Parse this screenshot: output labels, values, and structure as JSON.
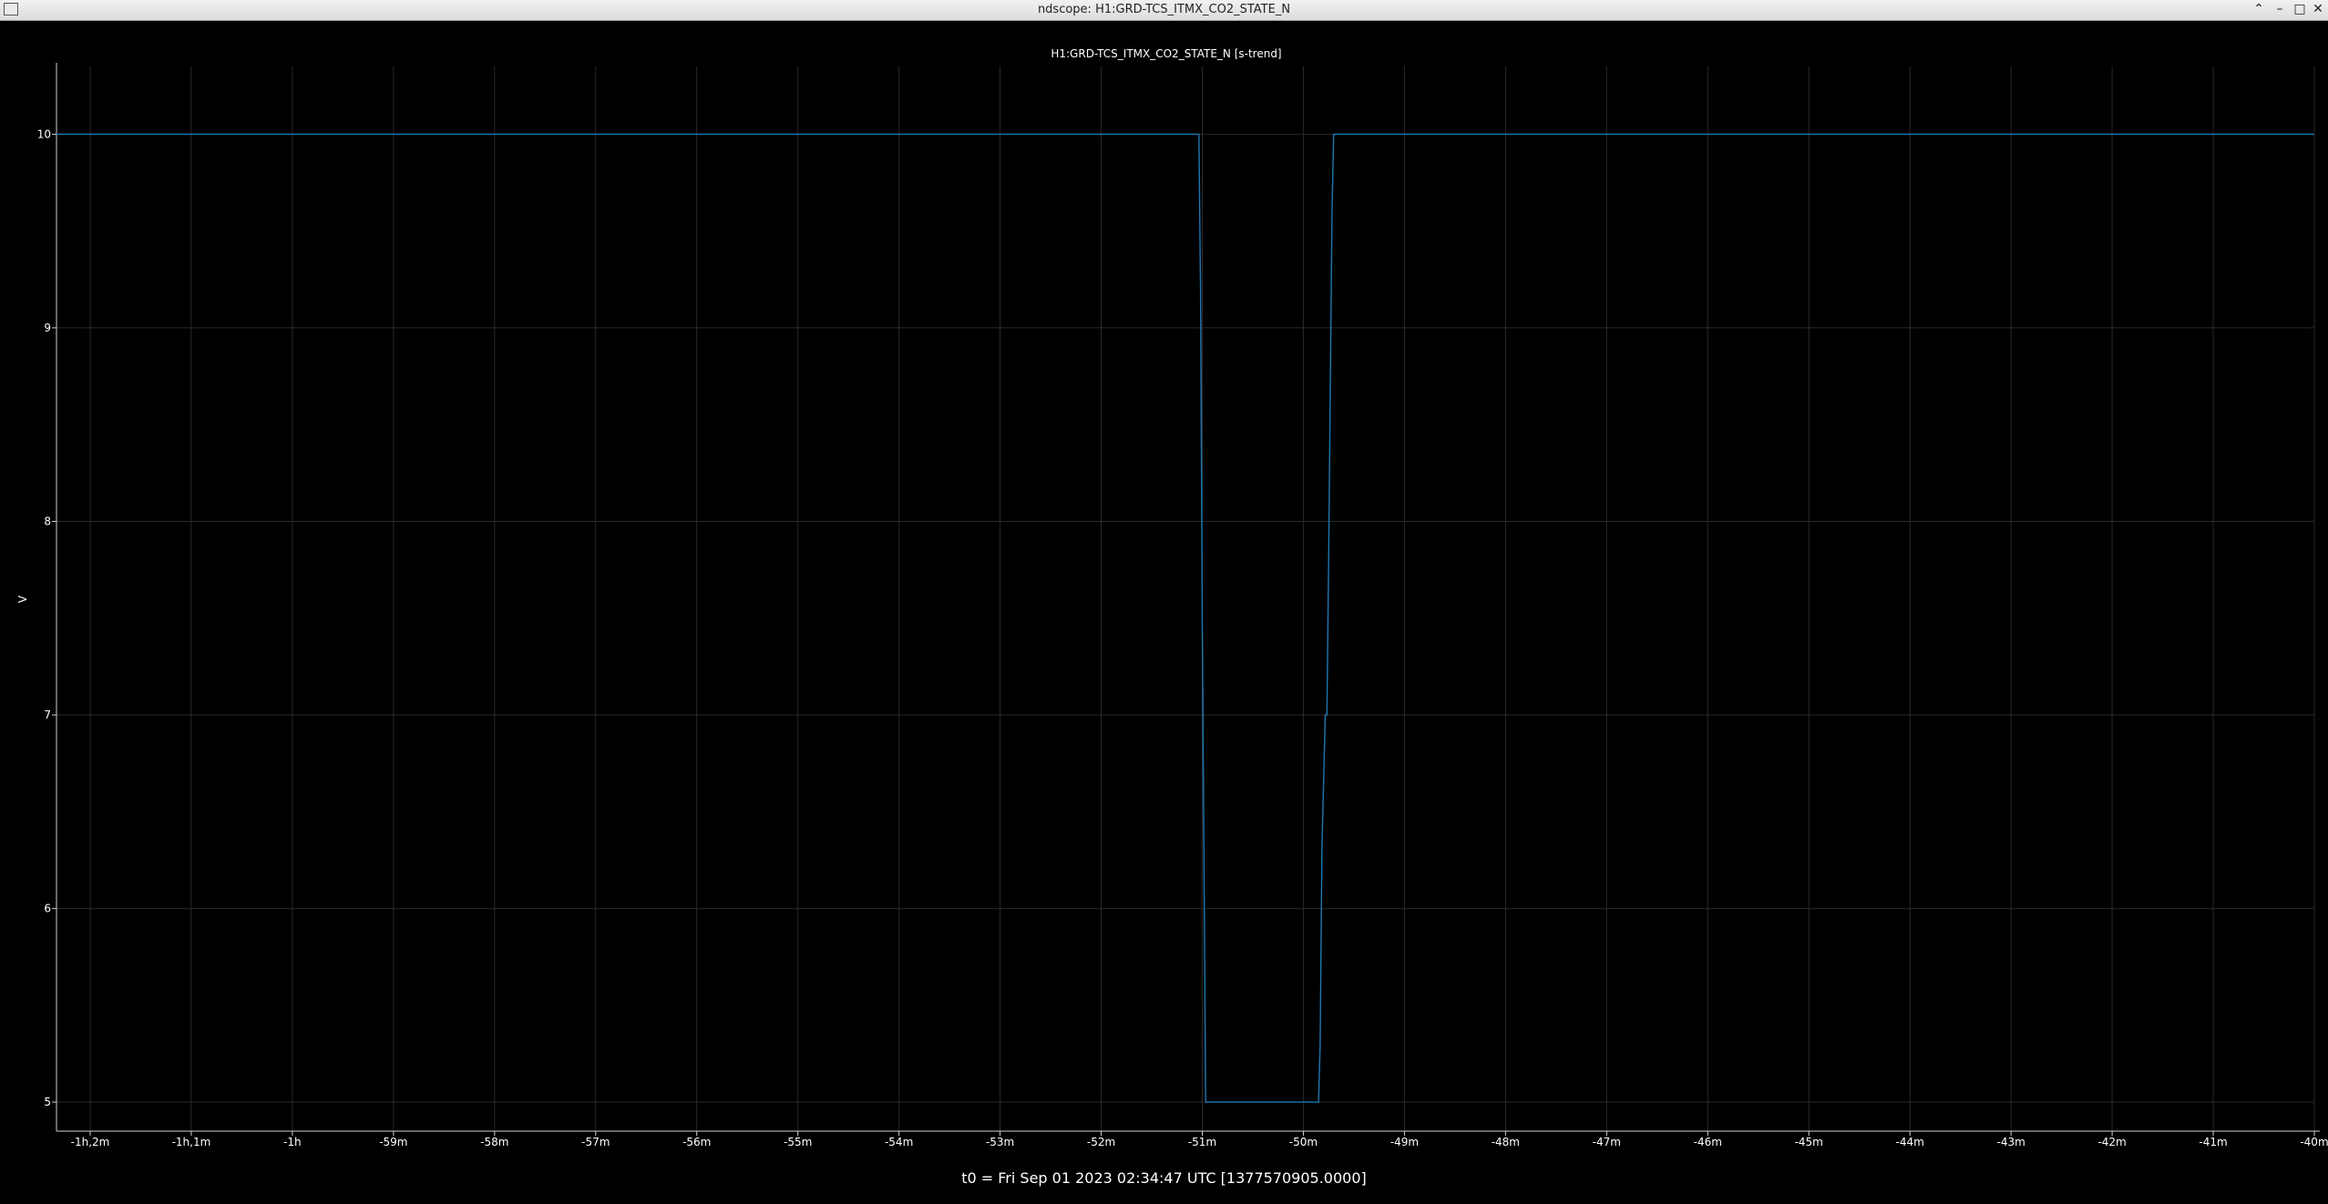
{
  "window": {
    "title": "ndscope: H1:GRD-TCS_ITMX_CO2_STATE_N",
    "buttons": {
      "up": "⌃",
      "minimize": "–",
      "maximize": "□",
      "close": "✕"
    }
  },
  "plot": {
    "colors": {
      "background": "#000000",
      "trace": "#1f77b4",
      "grid": "#2a2a2a",
      "axis": "#cfcfcf",
      "text": "#ffffff"
    },
    "t0_label": "t0 = Fri Sep 01 2023 02:34:47 UTC [1377570905.0000]"
  },
  "chart_data": {
    "type": "line",
    "title": "H1:GRD-TCS_ITMX_CO2_STATE_N [s-trend]",
    "xlabel": "",
    "ylabel": "V",
    "xlim": [
      -3740,
      -2400
    ],
    "ylim": [
      4.85,
      10.35
    ],
    "x_ticks": [
      {
        "v": -3720,
        "label": "-1h,2m"
      },
      {
        "v": -3660,
        "label": "-1h,1m"
      },
      {
        "v": -3600,
        "label": "-1h"
      },
      {
        "v": -3540,
        "label": "-59m"
      },
      {
        "v": -3480,
        "label": "-58m"
      },
      {
        "v": -3420,
        "label": "-57m"
      },
      {
        "v": -3360,
        "label": "-56m"
      },
      {
        "v": -3300,
        "label": "-55m"
      },
      {
        "v": -3240,
        "label": "-54m"
      },
      {
        "v": -3180,
        "label": "-53m"
      },
      {
        "v": -3120,
        "label": "-52m"
      },
      {
        "v": -3060,
        "label": "-51m"
      },
      {
        "v": -3000,
        "label": "-50m"
      },
      {
        "v": -2940,
        "label": "-49m"
      },
      {
        "v": -2880,
        "label": "-48m"
      },
      {
        "v": -2820,
        "label": "-47m"
      },
      {
        "v": -2760,
        "label": "-46m"
      },
      {
        "v": -2700,
        "label": "-45m"
      },
      {
        "v": -2640,
        "label": "-44m"
      },
      {
        "v": -2580,
        "label": "-43m"
      },
      {
        "v": -2520,
        "label": "-42m"
      },
      {
        "v": -2460,
        "label": "-41m"
      },
      {
        "v": -2400,
        "label": "-40m"
      }
    ],
    "y_ticks": [
      5,
      6,
      7,
      8,
      9,
      10
    ],
    "grid": true,
    "series": [
      {
        "x": [
          -3740,
          -3062,
          -3061,
          -3060,
          -3059,
          -3058,
          -2991,
          -2990,
          -2989,
          -2987,
          -2986,
          -2985,
          -2983,
          -2982,
          -2400
        ],
        "y": [
          10,
          10,
          9.2,
          7.5,
          6.3,
          5,
          5,
          5.3,
          6.3,
          7,
          7,
          7.8,
          9.6,
          10,
          10
        ]
      }
    ]
  }
}
